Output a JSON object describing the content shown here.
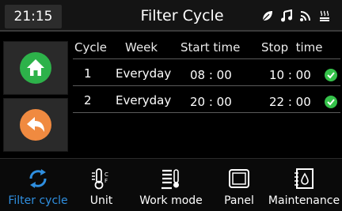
{
  "header": {
    "time": "21:15",
    "title": "Filter Cycle",
    "status_icons": [
      "leaf-icon",
      "music-icon",
      "wifi-icon",
      "heater-icon"
    ]
  },
  "side": {
    "buttons": [
      {
        "name": "home-button",
        "icon": "home-icon",
        "color": "#2db24a"
      },
      {
        "name": "back-button",
        "icon": "back-arrow-icon",
        "color": "#f08a40"
      }
    ]
  },
  "table": {
    "headers": [
      "Cycle",
      "Week",
      "Start time",
      "Stop  time"
    ],
    "rows": [
      {
        "cycle": "1",
        "week": "Everyday",
        "start": "08 : 00",
        "stop": "10 : 00",
        "enabled": true
      },
      {
        "cycle": "2",
        "week": "Everyday",
        "start": "20 : 00",
        "stop": "22 : 00",
        "enabled": true
      }
    ]
  },
  "nav": {
    "items": [
      {
        "label": "Filter cycle",
        "icon": "refresh-cycle-icon",
        "active": true
      },
      {
        "label": "Unit",
        "icon": "thermometer-unit-icon",
        "active": false
      },
      {
        "label": "Work mode",
        "icon": "heating-mode-icon",
        "active": false
      },
      {
        "label": "Panel",
        "icon": "panel-icon",
        "active": false
      },
      {
        "label": "Maintenance",
        "icon": "maintenance-icon",
        "active": false
      }
    ]
  },
  "colors": {
    "accent": "#2f8fe0",
    "check": "#35c24a",
    "home": "#2db24a",
    "back": "#f08a40"
  }
}
